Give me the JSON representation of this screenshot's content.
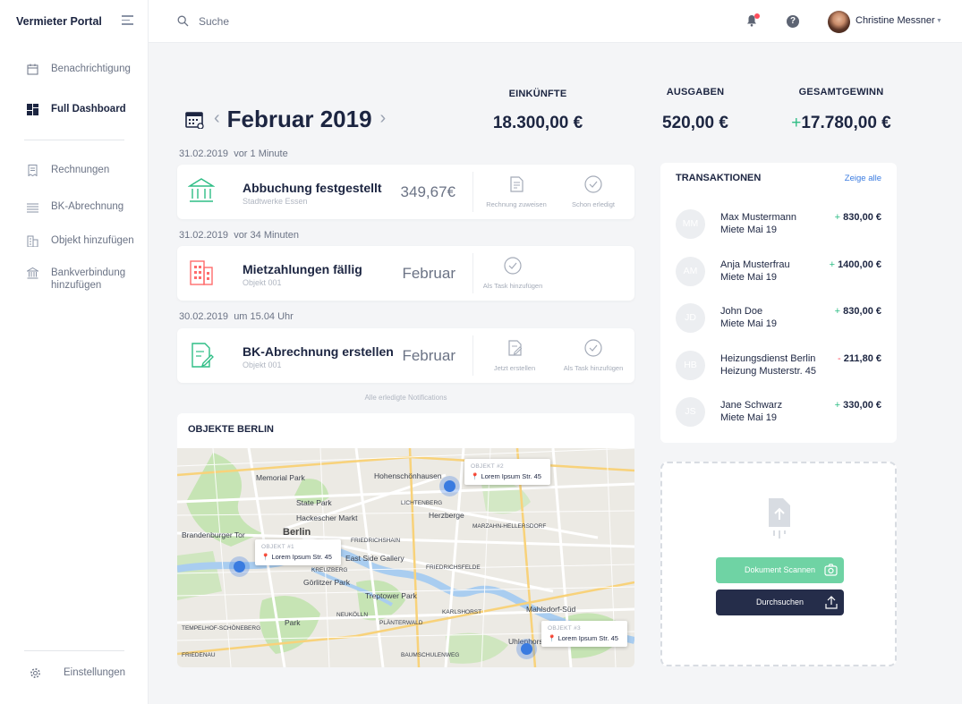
{
  "brand": "Vermieter Portal",
  "sidebar": {
    "items": [
      {
        "label": "Benachrichtigung",
        "icon": "calendar-icon"
      },
      {
        "label": "Full Dashboard",
        "icon": "dashboard-icon"
      },
      {
        "label": "Rechnungen",
        "icon": "receipt-icon"
      },
      {
        "label": "BK-Abrechnung",
        "icon": "list-icon"
      },
      {
        "label": "Objekt hinzufügen",
        "icon": "building-icon"
      },
      {
        "label": "Bankverbindung hinzufügen",
        "icon": "bank-icon"
      }
    ],
    "settings_label": "Einstellungen"
  },
  "topbar": {
    "search_placeholder": "Suche",
    "user_name": "Christine Messner"
  },
  "period": {
    "month": "Februar 2019"
  },
  "kpis": [
    {
      "label": "EINKÜNFTE",
      "value": "18.300,00 €"
    },
    {
      "label": "AUSGABEN",
      "value": "520,00 €"
    },
    {
      "label": "GESAMTGEWINN",
      "sign": "+",
      "value": "17.780,00 €"
    }
  ],
  "notifications": [
    {
      "date": "31.02.2019",
      "time": "vor 1 Minute",
      "title": "Abbuchung festgestellt",
      "sub": "Stadtwerke Essen",
      "amount": "349,67€",
      "icon": "bank-icon",
      "icon_color": "#2ebd85",
      "actions": [
        "Rechnung zuweisen",
        "Schon erledigt"
      ]
    },
    {
      "date": "31.02.2019",
      "time": "vor 34 Minuten",
      "title": "Mietzahlungen fällig",
      "sub": "Objekt 001",
      "amount": "Februar",
      "icon": "building-icon",
      "icon_color": "#ff6b6b",
      "actions": [
        "Als Task hinzufügen"
      ]
    },
    {
      "date": "30.02.2019",
      "time": "um 15.04 Uhr",
      "title": "BK-Abrechnung erstellen",
      "sub": "Objekt 001",
      "amount": "Februar",
      "icon": "document-edit-icon",
      "icon_color": "#2ebd85",
      "actions": [
        "Jetzt erstellen",
        "Als Task hinzufügen"
      ]
    }
  ],
  "all_notifications_label": "Alle erledigte Notifications",
  "map": {
    "title": "OBJEKTE BERLIN",
    "city_label": "Berlin",
    "places": [
      "Hohenschönhausen",
      "Herzberge",
      "Memorial Park",
      "State Park",
      "Hackescher Markt",
      "Brandenburger Tor",
      "East Side Gallery",
      "Görlitzer Park",
      "Treptower Park",
      "Park",
      "Mahlsdorf-Süd",
      "Uhlenhorst",
      "FRIEDRICHSHAIN",
      "LICHTENBERG",
      "KREUZBERG",
      "NEUKÖLLN",
      "KARLSHORST",
      "MARZAHN-HELLERSDORF",
      "FRIEDENAU",
      "TEMPELHOF-SCHÖNEBERG",
      "PLÄNTERWALD",
      "BAUMSCHULENWEG",
      "FRIEDRICHSFELDE"
    ],
    "markers": [
      {
        "head": "OBJEKT #1",
        "address": "Lorem Ipsum Str. 45"
      },
      {
        "head": "OBJEKT #2",
        "address": "Lorem Ipsum Str. 45"
      },
      {
        "head": "OBJEKT #3",
        "address": "Lorem Ipsum Str. 45"
      }
    ]
  },
  "transactions": {
    "title": "TRANSAKTIONEN",
    "show_all": "Zeige alle",
    "rows": [
      {
        "initials": "MM",
        "name": "Max Mustermann",
        "sub": "Miete Mai 19",
        "sign": "+",
        "amount": "830,00 €"
      },
      {
        "initials": "AM",
        "name": "Anja Musterfrau",
        "sub": "Miete Mai 19",
        "sign": "+",
        "amount": "1400,00 €"
      },
      {
        "initials": "JD",
        "name": "John Doe",
        "sub": "Miete Mai 19",
        "sign": "+",
        "amount": "830,00 €"
      },
      {
        "initials": "HB",
        "name": "Heizungsdienst Berlin",
        "sub": "Heizung Musterstr. 45",
        "sign": "-",
        "amount": "211,80 €"
      },
      {
        "initials": "JS",
        "name": "Jane Schwarz",
        "sub": "Miete Mai 19",
        "sign": "+",
        "amount": "330,00 €"
      }
    ]
  },
  "upload": {
    "scan_label": "Dokument Scannen",
    "browse_label": "Durchsuchen"
  },
  "colors": {
    "accent": "#2ebd85",
    "negative": "#ff4d5b",
    "navy": "#1c2541",
    "link": "#3a7be0"
  }
}
